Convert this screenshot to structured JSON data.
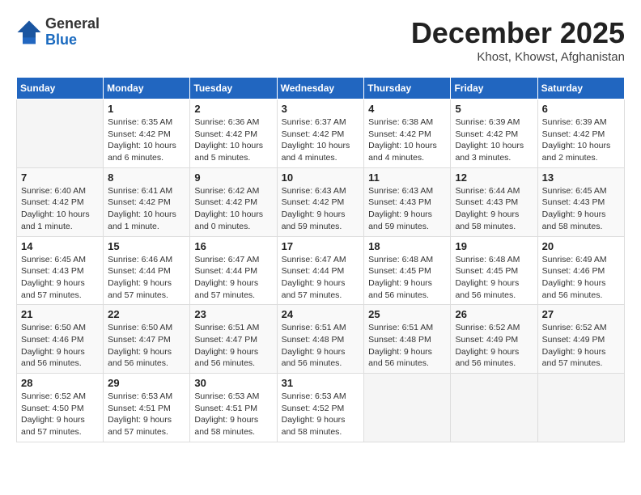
{
  "header": {
    "logo_general": "General",
    "logo_blue": "Blue",
    "month_title": "December 2025",
    "location": "Khost, Khowst, Afghanistan"
  },
  "days_of_week": [
    "Sunday",
    "Monday",
    "Tuesday",
    "Wednesday",
    "Thursday",
    "Friday",
    "Saturday"
  ],
  "weeks": [
    [
      {
        "day": "",
        "content": ""
      },
      {
        "day": "1",
        "content": "Sunrise: 6:35 AM\nSunset: 4:42 PM\nDaylight: 10 hours\nand 6 minutes."
      },
      {
        "day": "2",
        "content": "Sunrise: 6:36 AM\nSunset: 4:42 PM\nDaylight: 10 hours\nand 5 minutes."
      },
      {
        "day": "3",
        "content": "Sunrise: 6:37 AM\nSunset: 4:42 PM\nDaylight: 10 hours\nand 4 minutes."
      },
      {
        "day": "4",
        "content": "Sunrise: 6:38 AM\nSunset: 4:42 PM\nDaylight: 10 hours\nand 4 minutes."
      },
      {
        "day": "5",
        "content": "Sunrise: 6:39 AM\nSunset: 4:42 PM\nDaylight: 10 hours\nand 3 minutes."
      },
      {
        "day": "6",
        "content": "Sunrise: 6:39 AM\nSunset: 4:42 PM\nDaylight: 10 hours\nand 2 minutes."
      }
    ],
    [
      {
        "day": "7",
        "content": "Sunrise: 6:40 AM\nSunset: 4:42 PM\nDaylight: 10 hours\nand 1 minute."
      },
      {
        "day": "8",
        "content": "Sunrise: 6:41 AM\nSunset: 4:42 PM\nDaylight: 10 hours\nand 1 minute."
      },
      {
        "day": "9",
        "content": "Sunrise: 6:42 AM\nSunset: 4:42 PM\nDaylight: 10 hours\nand 0 minutes."
      },
      {
        "day": "10",
        "content": "Sunrise: 6:43 AM\nSunset: 4:42 PM\nDaylight: 9 hours\nand 59 minutes."
      },
      {
        "day": "11",
        "content": "Sunrise: 6:43 AM\nSunset: 4:43 PM\nDaylight: 9 hours\nand 59 minutes."
      },
      {
        "day": "12",
        "content": "Sunrise: 6:44 AM\nSunset: 4:43 PM\nDaylight: 9 hours\nand 58 minutes."
      },
      {
        "day": "13",
        "content": "Sunrise: 6:45 AM\nSunset: 4:43 PM\nDaylight: 9 hours\nand 58 minutes."
      }
    ],
    [
      {
        "day": "14",
        "content": "Sunrise: 6:45 AM\nSunset: 4:43 PM\nDaylight: 9 hours\nand 57 minutes."
      },
      {
        "day": "15",
        "content": "Sunrise: 6:46 AM\nSunset: 4:44 PM\nDaylight: 9 hours\nand 57 minutes."
      },
      {
        "day": "16",
        "content": "Sunrise: 6:47 AM\nSunset: 4:44 PM\nDaylight: 9 hours\nand 57 minutes."
      },
      {
        "day": "17",
        "content": "Sunrise: 6:47 AM\nSunset: 4:44 PM\nDaylight: 9 hours\nand 57 minutes."
      },
      {
        "day": "18",
        "content": "Sunrise: 6:48 AM\nSunset: 4:45 PM\nDaylight: 9 hours\nand 56 minutes."
      },
      {
        "day": "19",
        "content": "Sunrise: 6:48 AM\nSunset: 4:45 PM\nDaylight: 9 hours\nand 56 minutes."
      },
      {
        "day": "20",
        "content": "Sunrise: 6:49 AM\nSunset: 4:46 PM\nDaylight: 9 hours\nand 56 minutes."
      }
    ],
    [
      {
        "day": "21",
        "content": "Sunrise: 6:50 AM\nSunset: 4:46 PM\nDaylight: 9 hours\nand 56 minutes."
      },
      {
        "day": "22",
        "content": "Sunrise: 6:50 AM\nSunset: 4:47 PM\nDaylight: 9 hours\nand 56 minutes."
      },
      {
        "day": "23",
        "content": "Sunrise: 6:51 AM\nSunset: 4:47 PM\nDaylight: 9 hours\nand 56 minutes."
      },
      {
        "day": "24",
        "content": "Sunrise: 6:51 AM\nSunset: 4:48 PM\nDaylight: 9 hours\nand 56 minutes."
      },
      {
        "day": "25",
        "content": "Sunrise: 6:51 AM\nSunset: 4:48 PM\nDaylight: 9 hours\nand 56 minutes."
      },
      {
        "day": "26",
        "content": "Sunrise: 6:52 AM\nSunset: 4:49 PM\nDaylight: 9 hours\nand 56 minutes."
      },
      {
        "day": "27",
        "content": "Sunrise: 6:52 AM\nSunset: 4:49 PM\nDaylight: 9 hours\nand 57 minutes."
      }
    ],
    [
      {
        "day": "28",
        "content": "Sunrise: 6:52 AM\nSunset: 4:50 PM\nDaylight: 9 hours\nand 57 minutes."
      },
      {
        "day": "29",
        "content": "Sunrise: 6:53 AM\nSunset: 4:51 PM\nDaylight: 9 hours\nand 57 minutes."
      },
      {
        "day": "30",
        "content": "Sunrise: 6:53 AM\nSunset: 4:51 PM\nDaylight: 9 hours\nand 58 minutes."
      },
      {
        "day": "31",
        "content": "Sunrise: 6:53 AM\nSunset: 4:52 PM\nDaylight: 9 hours\nand 58 minutes."
      },
      {
        "day": "",
        "content": ""
      },
      {
        "day": "",
        "content": ""
      },
      {
        "day": "",
        "content": ""
      }
    ]
  ]
}
